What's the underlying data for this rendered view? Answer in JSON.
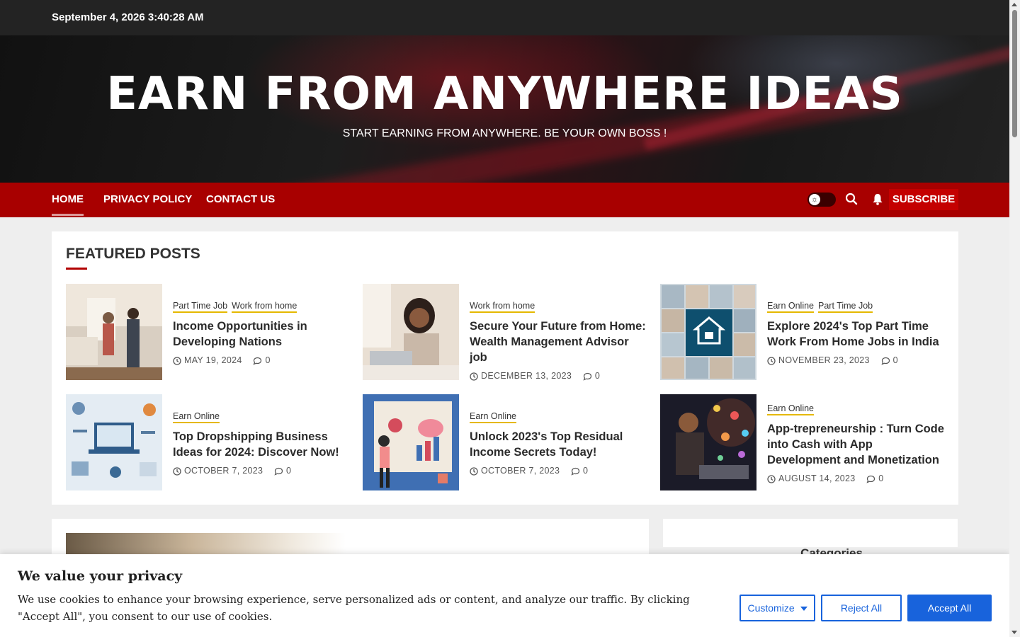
{
  "topbar": {
    "datetime": "September 4, 2026 3:40:28 AM"
  },
  "site": {
    "title": "EARN FROM ANYWHERE IDEAS",
    "tagline": "START EARNING FROM ANYWHERE. BE YOUR OWN BOSS !"
  },
  "nav": {
    "items": [
      {
        "label": "HOME",
        "active": true
      },
      {
        "label": "PRIVACY POLICY"
      },
      {
        "label": "CONTACT US"
      }
    ],
    "subscribe_label": "SUBSCRIBE",
    "accent": "#a80000"
  },
  "featured": {
    "heading": "FEATURED POSTS",
    "posts": [
      {
        "categories": [
          "Part Time Job",
          "Work from home"
        ],
        "title": "Income Opportunities in Developing Nations",
        "date": "MAY 19, 2024",
        "comments": "0"
      },
      {
        "categories": [
          "Work from home"
        ],
        "title": "Secure Your Future from Home: Wealth Management Advisor job",
        "date": "DECEMBER 13, 2023",
        "comments": "0"
      },
      {
        "categories": [
          "Earn Online",
          "Part Time Job"
        ],
        "title": "Explore 2024's Top Part Time Work From Home Jobs in India",
        "date": "NOVEMBER 23, 2023",
        "comments": "0"
      },
      {
        "categories": [
          "Earn Online"
        ],
        "title": "Top Dropshipping Business Ideas for 2024: Discover Now!",
        "date": "OCTOBER 7, 2023",
        "comments": "0"
      },
      {
        "categories": [
          "Earn Online"
        ],
        "title": "Unlock 2023's Top Residual Income Secrets Today!",
        "date": "OCTOBER 7, 2023",
        "comments": "0"
      },
      {
        "categories": [
          "Earn Online"
        ],
        "title": "App-trepreneurship : Turn Code into Cash with App Development and Monetization",
        "date": "AUGUST 14, 2023",
        "comments": "0"
      }
    ]
  },
  "sidebar": {
    "title": "Categories"
  },
  "cookie": {
    "title": "We value your privacy",
    "text": "We use cookies to enhance your browsing experience, serve personalized ads or content, and analyze our traffic. By clicking \"Accept All\", you consent to our use of cookies.",
    "customize_label": "Customize",
    "reject_label": "Reject All",
    "accept_label": "Accept All",
    "accent": "#1863dc"
  }
}
